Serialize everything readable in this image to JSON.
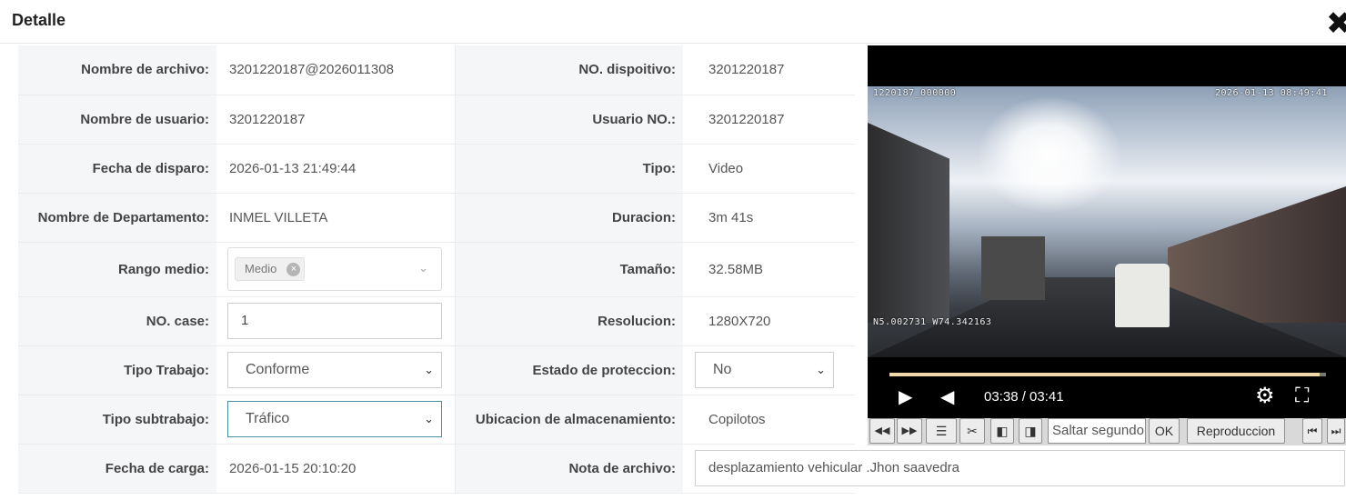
{
  "dialog": {
    "title": "Detalle",
    "close_symbol": "✖"
  },
  "fields": {
    "nombre_archivo": {
      "label": "Nombre de archivo:",
      "value": "3201220187@2026011308"
    },
    "no_dispositivo": {
      "label": "NO. dispoitivo:",
      "value": "3201220187"
    },
    "nombre_usuario": {
      "label": "Nombre de usuario:",
      "value": "3201220187"
    },
    "usuario_no": {
      "label": "Usuario NO.:",
      "value": "3201220187"
    },
    "fecha_disparo": {
      "label": "Fecha de disparo:",
      "value": "2026-01-13 21:49:44"
    },
    "tipo": {
      "label": "Tipo:",
      "value": "Video"
    },
    "departamento": {
      "label": "Nombre de Departamento:",
      "value": "INMEL VILLETA"
    },
    "duracion": {
      "label": "Duracion:",
      "value": "3m 41s"
    },
    "rango_medio": {
      "label": "Rango medio:",
      "chip": "Medio"
    },
    "tamano": {
      "label": "Tamaño:",
      "value": "32.58MB"
    },
    "no_case": {
      "label": "NO. case:",
      "value": "1"
    },
    "resolucion": {
      "label": "Resolucion:",
      "value": "1280X720"
    },
    "tipo_trabajo": {
      "label": "Tipo Trabajo:",
      "selected": "Conforme"
    },
    "estado_proteccion": {
      "label": "Estado de proteccion:",
      "selected": "No"
    },
    "tipo_subtrabajo": {
      "label": "Tipo subtrabajo:",
      "selected": "Tráfico"
    },
    "ubicacion": {
      "label": "Ubicacion de almacenamiento:",
      "value": "Copilotos"
    },
    "fecha_carga": {
      "label": "Fecha de carga:",
      "value": "2026-01-15 20:10:20"
    },
    "nota_archivo": {
      "label": "Nota de archivo:",
      "value": "desplazamiento vehicular .Jhon saavedra"
    }
  },
  "player": {
    "osd_id": "1220187_000000",
    "osd_datetime": "2026-01-13 08:49:41",
    "osd_gps": "N5.002731 W74.342163",
    "time_display": "03:38 / 03:41",
    "progress_fraction": 0.985
  },
  "toolbar": {
    "skip_placeholder": "Saltar segundo",
    "ok_label": "OK",
    "reproduccion_label": "Reproduccion"
  },
  "icons": {
    "rewind": "◀◀",
    "forward": "▶▶",
    "list": "☰",
    "scissors": "✂",
    "frame_back": "◧",
    "frame_forward": "◨",
    "play": "▶",
    "volume": "◀",
    "gear": "⚙",
    "fullscreen": "⛶",
    "skip_start": "⏮",
    "skip_end": "⏭",
    "chevron_down": "⌄",
    "clear": "×"
  },
  "colors": {
    "label_bg": "#f5f6f8",
    "progress_fill": "#f0d9a8",
    "player_bg": "#000000"
  }
}
